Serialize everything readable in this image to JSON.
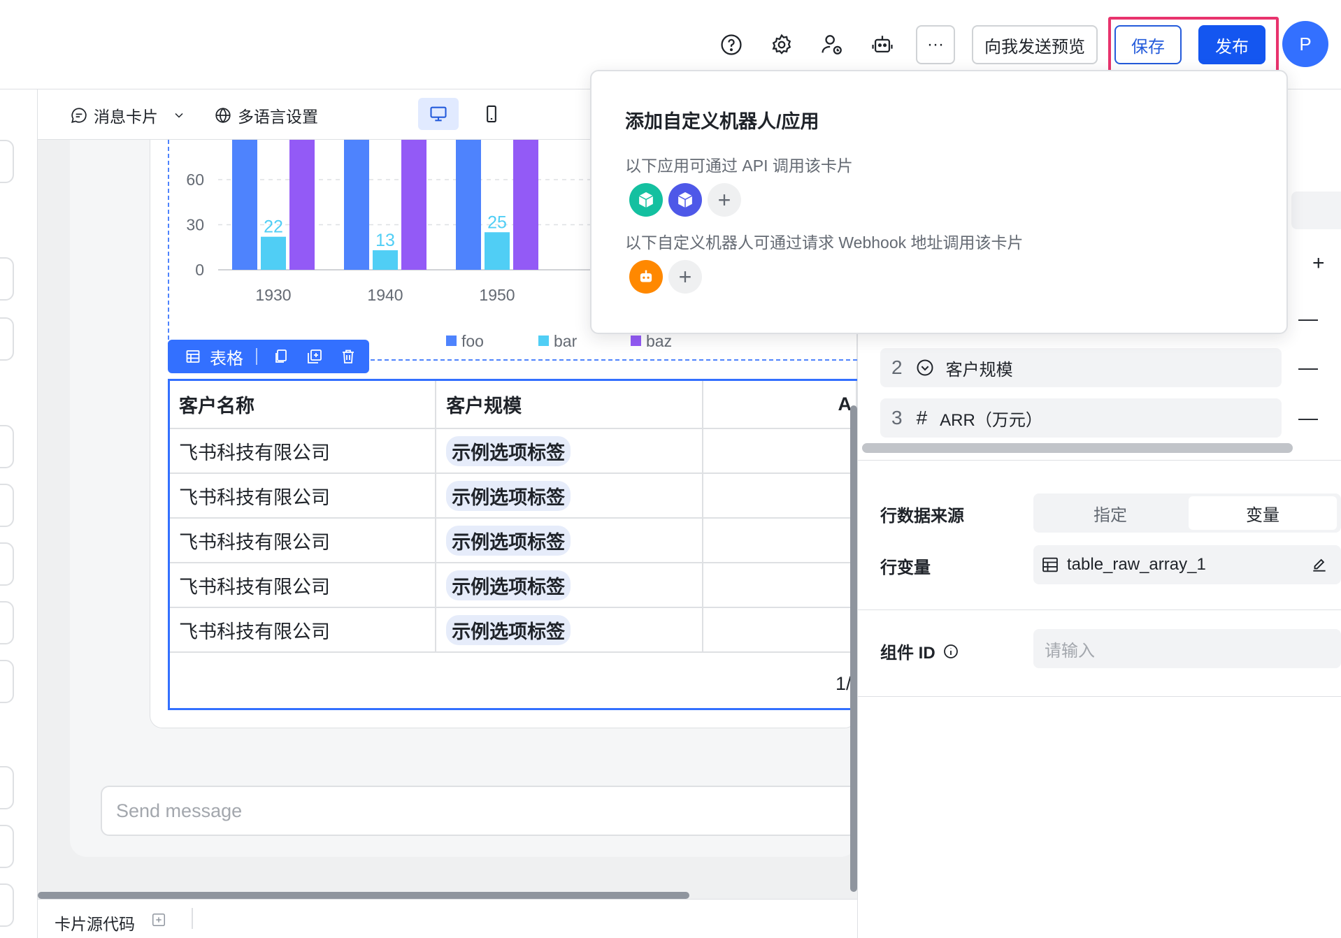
{
  "header": {
    "send_preview": "向我发送预览",
    "save": "保存",
    "publish": "发布",
    "avatar": "P",
    "more": "···"
  },
  "toolbar": {
    "card_type": "消息卡片",
    "multilang": "多语言设置"
  },
  "chart_data": {
    "type": "bar",
    "categories": [
      "1930",
      "1940",
      "1950"
    ],
    "series": [
      {
        "name": "foo",
        "values": [
          null,
          null,
          null
        ],
        "color": "#4e83fd"
      },
      {
        "name": "bar",
        "values": [
          22,
          13,
          25
        ],
        "color": "#50cef5"
      },
      {
        "name": "baz",
        "values": [
          null,
          null,
          null
        ],
        "color": "#935af6"
      }
    ],
    "yticks": [
      "60",
      "30",
      "0"
    ],
    "legend": [
      "foo",
      "bar",
      "baz"
    ]
  },
  "table_toolbar": {
    "label": "表格"
  },
  "table": {
    "headers": [
      "客户名称",
      "客户规模",
      "A"
    ],
    "rows": [
      {
        "name": "飞书科技有限公司",
        "tag": "示例选项标签"
      },
      {
        "name": "飞书科技有限公司",
        "tag": "示例选项标签"
      },
      {
        "name": "飞书科技有限公司",
        "tag": "示例选项标签"
      },
      {
        "name": "飞书科技有限公司",
        "tag": "示例选项标签"
      },
      {
        "name": "飞书科技有限公司",
        "tag": "示例选项标签"
      }
    ],
    "pagination": "1/"
  },
  "message_input": {
    "placeholder": "Send message"
  },
  "bottom_tab": {
    "label": "卡片源代码"
  },
  "right_panel": {
    "columns": [
      {
        "index": "2",
        "icon": "dropdown-circle-icon",
        "label": "客户规模"
      },
      {
        "index": "3",
        "icon": "hash-icon",
        "label": "ARR（万元）"
      }
    ],
    "row_source_label": "行数据来源",
    "row_source_options": [
      "指定",
      "变量"
    ],
    "row_var_label": "行变量",
    "row_var_value": "table_raw_array_1",
    "component_id_label": "组件 ID",
    "component_id_placeholder": "请输入"
  },
  "popover": {
    "title": "添加自定义机器人/应用",
    "api_desc": "以下应用可通过 API 调用该卡片",
    "webhook_desc": "以下自定义机器人可通过请求 Webhook 地址调用该卡片"
  }
}
